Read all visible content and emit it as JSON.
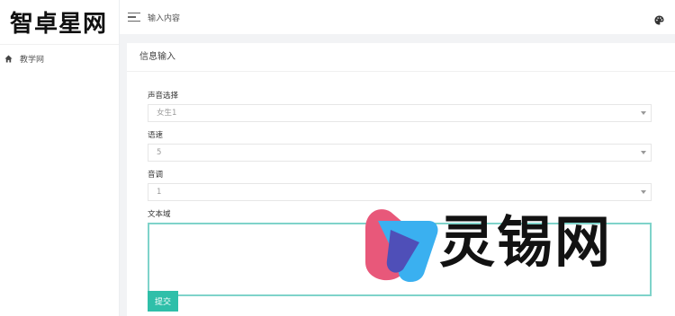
{
  "brand": {
    "logo_text": "智卓星网"
  },
  "sidebar": {
    "items": [
      {
        "label": "教学网",
        "icon": "home-icon"
      }
    ]
  },
  "header": {
    "title": "输入内容",
    "menu_icon": "menu-icon",
    "theme_icon": "palette-icon"
  },
  "panel": {
    "title": "信息输入"
  },
  "form": {
    "voice": {
      "label": "声音选择",
      "value": "女生1"
    },
    "speed": {
      "label": "语速",
      "value": "5"
    },
    "pitch": {
      "label": "音调",
      "value": "1"
    },
    "text": {
      "label": "文本域",
      "value": ""
    },
    "submit_label": "提交"
  },
  "watermark": {
    "text": "灵锡网",
    "colors": {
      "pink": "#e8587a",
      "blue": "#3ab0f0",
      "overlap": "#4f4fb8"
    }
  },
  "colors": {
    "accent": "#2fbfa9",
    "textarea_border": "#7fd3ca"
  }
}
